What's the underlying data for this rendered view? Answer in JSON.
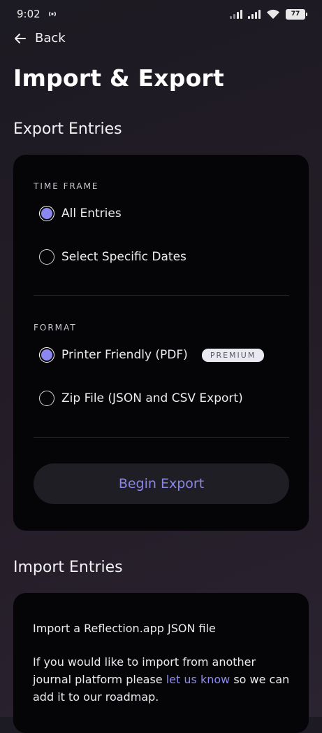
{
  "status_bar": {
    "time": "9:02",
    "battery": "77"
  },
  "nav": {
    "back_label": "Back"
  },
  "title": "Import & Export",
  "export": {
    "heading": "Export Entries",
    "time_frame_label": "TIME FRAME",
    "time_frame_options": [
      {
        "label": "All Entries",
        "selected": true
      },
      {
        "label": "Select Specific Dates",
        "selected": false
      }
    ],
    "format_label": "FORMAT",
    "format_options": [
      {
        "label": "Printer Friendly (PDF)",
        "selected": true,
        "badge": "PREMIUM"
      },
      {
        "label": "Zip File (JSON and CSV Export)",
        "selected": false
      }
    ],
    "button_label": "Begin Export"
  },
  "import": {
    "heading": "Import Entries",
    "line1": "Import a Reflection.app JSON file",
    "para_before_link": "If you would like to import from another journal platform please ",
    "link_text": "let us know",
    "para_after_link": " so we can add it to our roadmap."
  },
  "colors": {
    "accent": "#8b86f0",
    "card": "#050507",
    "button_text": "#8a86e6"
  }
}
